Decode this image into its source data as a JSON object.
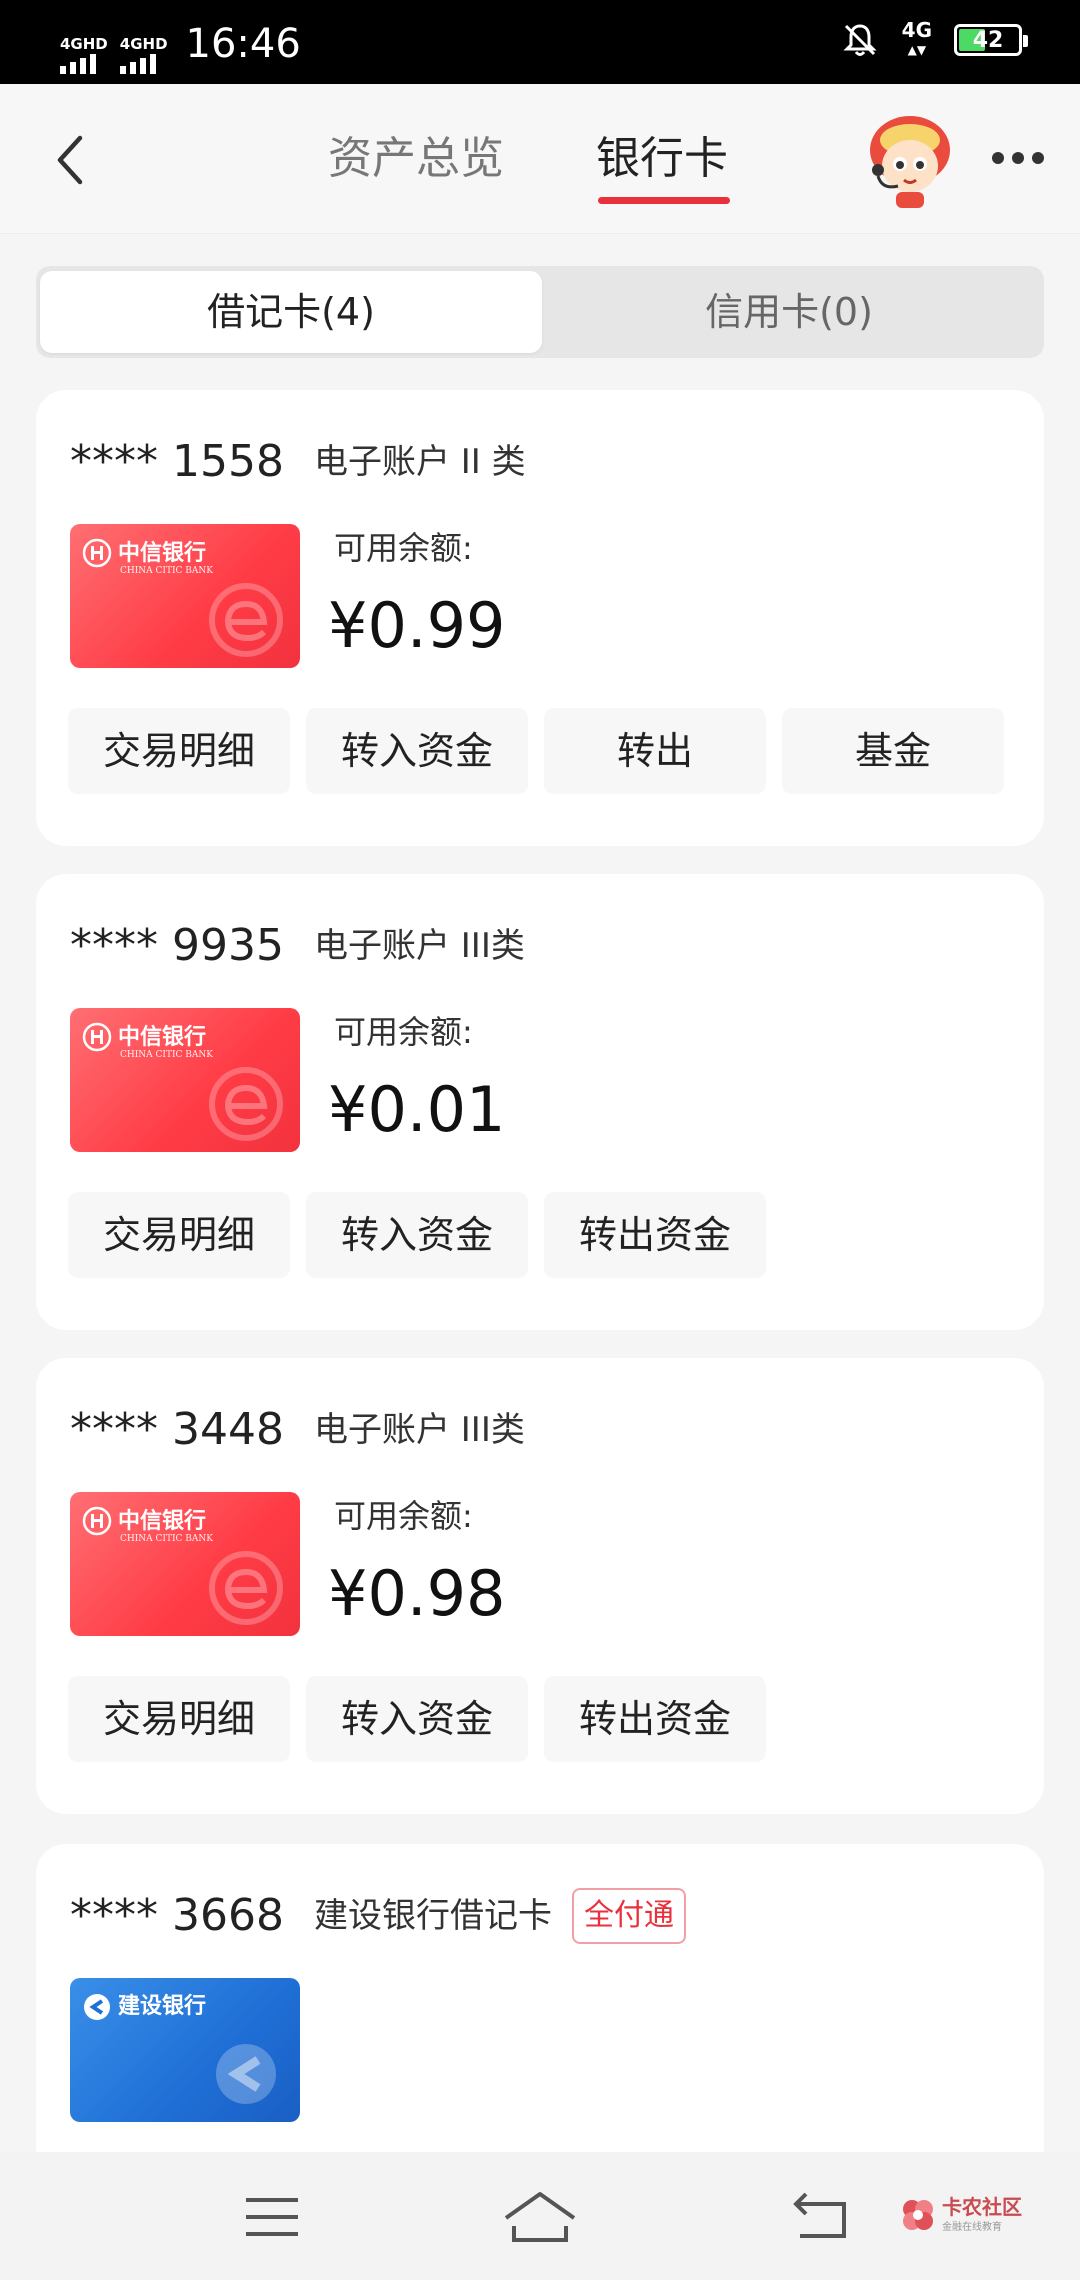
{
  "status_bar": {
    "sim1_label": "4GHD",
    "sim2_label": "4GHD",
    "time": "16:46",
    "network": "4G",
    "battery": "42",
    "battery_level": 0.42
  },
  "header": {
    "tabs": [
      {
        "label": "资产总览",
        "active": false
      },
      {
        "label": "银行卡",
        "active": true
      }
    ],
    "accent_color": "#e8313d"
  },
  "segment": {
    "debit_label": "借记卡(4)",
    "credit_label": "信用卡(0)"
  },
  "cards": [
    {
      "account": "**** 1558",
      "type": "电子账户 II 类",
      "bank_card": {
        "bank": "中信银行",
        "bank_en": "CHINA CITIC BANK"
      },
      "balance_label": "可用余额:",
      "balance": "¥0.99",
      "actions": [
        "交易明细",
        "转入资金",
        "转出",
        "基金"
      ]
    },
    {
      "account": "**** 9935",
      "type": "电子账户 III类",
      "bank_card": {
        "bank": "中信银行",
        "bank_en": "CHINA CITIC BANK"
      },
      "balance_label": "可用余额:",
      "balance": "¥0.01",
      "actions": [
        "交易明细",
        "转入资金",
        "转出资金"
      ]
    },
    {
      "account": "**** 3448",
      "type": "电子账户 III类",
      "bank_card": {
        "bank": "中信银行",
        "bank_en": "CHINA CITIC BANK"
      },
      "balance_label": "可用余额:",
      "balance": "¥0.98",
      "actions": [
        "交易明细",
        "转入资金",
        "转出资金"
      ]
    },
    {
      "account": "**** 3668",
      "type": "建设银行借记卡",
      "badge": "全付通",
      "bank_card": {
        "bank": "建设银行"
      }
    }
  ],
  "watermark": {
    "title": "卡农社区",
    "subtitle": "金融在线教育"
  }
}
